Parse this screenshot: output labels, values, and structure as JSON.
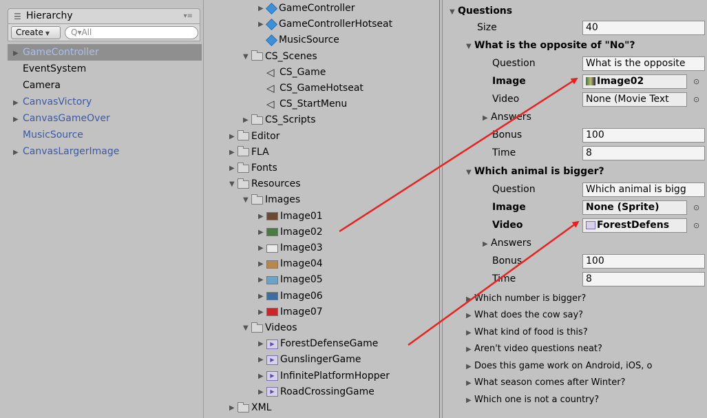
{
  "hierarchy": {
    "title": "Hierarchy",
    "create_label": "Create",
    "search_placeholder": "Q▾All",
    "items": [
      {
        "label": "GameController",
        "selected": true,
        "prefab": true,
        "expandable": true
      },
      {
        "label": "EventSystem",
        "selected": false,
        "prefab": false,
        "expandable": false
      },
      {
        "label": "Camera",
        "selected": false,
        "prefab": false,
        "expandable": false
      },
      {
        "label": "CanvasVictory",
        "selected": false,
        "prefab": true,
        "expandable": true
      },
      {
        "label": "CanvasGameOver",
        "selected": false,
        "prefab": true,
        "expandable": true
      },
      {
        "label": "MusicSource",
        "selected": false,
        "prefab": true,
        "expandable": false
      },
      {
        "label": "CanvasLargerImage",
        "selected": false,
        "prefab": true,
        "expandable": true
      }
    ]
  },
  "project": {
    "items": [
      {
        "label": "GameController",
        "icon": "prefab-cube-icon",
        "indent": 3,
        "tri": "▶"
      },
      {
        "label": "GameControllerHotseat",
        "icon": "prefab-cube-icon",
        "indent": 3,
        "tri": "▶"
      },
      {
        "label": "MusicSource",
        "icon": "prefab-cube-icon",
        "indent": 3,
        "tri": ""
      },
      {
        "label": "CS_Scenes",
        "icon": "folder-icon",
        "indent": 2,
        "tri": "▼"
      },
      {
        "label": "CS_Game",
        "icon": "unity-scene-icon",
        "indent": 3,
        "tri": ""
      },
      {
        "label": "CS_GameHotseat",
        "icon": "unity-scene-icon",
        "indent": 3,
        "tri": ""
      },
      {
        "label": "CS_StartMenu",
        "icon": "unity-scene-icon",
        "indent": 3,
        "tri": ""
      },
      {
        "label": "CS_Scripts",
        "icon": "folder-icon",
        "indent": 2,
        "tri": "▶"
      },
      {
        "label": "Editor",
        "icon": "folder-icon",
        "indent": 1,
        "tri": "▶"
      },
      {
        "label": "FLA",
        "icon": "folder-icon",
        "indent": 1,
        "tri": "▶"
      },
      {
        "label": "Fonts",
        "icon": "folder-icon",
        "indent": 1,
        "tri": "▶"
      },
      {
        "label": "Resources",
        "icon": "folder-icon",
        "indent": 1,
        "tri": "▼"
      },
      {
        "label": "Images",
        "icon": "folder-icon",
        "indent": 2,
        "tri": "▼"
      },
      {
        "label": "Image01",
        "icon": "image-thumbnail-icon",
        "indent": 3,
        "tri": "▶",
        "thumb": "#6b4a33"
      },
      {
        "label": "Image02",
        "icon": "image-thumbnail-icon",
        "indent": 3,
        "tri": "▶",
        "thumb": "#4d7a43"
      },
      {
        "label": "Image03",
        "icon": "image-thumbnail-icon",
        "indent": 3,
        "tri": "▶",
        "thumb": "#e9e9e9"
      },
      {
        "label": "Image04",
        "icon": "image-thumbnail-icon",
        "indent": 3,
        "tri": "▶",
        "thumb": "#b7874e"
      },
      {
        "label": "Image05",
        "icon": "image-thumbnail-icon",
        "indent": 3,
        "tri": "▶",
        "thumb": "#6aa3c8"
      },
      {
        "label": "Image06",
        "icon": "image-thumbnail-icon",
        "indent": 3,
        "tri": "▶",
        "thumb": "#3e6d9e"
      },
      {
        "label": "Image07",
        "icon": "image-thumbnail-icon",
        "indent": 3,
        "tri": "▶",
        "thumb": "#c8272c"
      },
      {
        "label": "Videos",
        "icon": "folder-icon",
        "indent": 2,
        "tri": "▼"
      },
      {
        "label": "ForestDefenseGame",
        "icon": "video-clip-icon",
        "indent": 3,
        "tri": "▶"
      },
      {
        "label": "GunslingerGame",
        "icon": "video-clip-icon",
        "indent": 3,
        "tri": "▶"
      },
      {
        "label": "InfinitePlatformHopper",
        "icon": "video-clip-icon",
        "indent": 3,
        "tri": "▶"
      },
      {
        "label": "RoadCrossingGame",
        "icon": "video-clip-icon",
        "indent": 3,
        "tri": "▶"
      },
      {
        "label": "XML",
        "icon": "folder-icon",
        "indent": 1,
        "tri": "▶"
      }
    ]
  },
  "inspector": {
    "questions_label": "Questions",
    "size_label": "Size",
    "size_value": "40",
    "q1": {
      "title": "What is the opposite of \"No\"?",
      "question_label": "Question",
      "question_value": "What is the opposite",
      "image_label": "Image",
      "image_value": "Image02",
      "video_label": "Video",
      "video_value": "None (Movie Text",
      "answers_label": "Answers",
      "bonus_label": "Bonus",
      "bonus_value": "100",
      "time_label": "Time",
      "time_value": "8"
    },
    "q2": {
      "title": "Which animal is bigger?",
      "question_label": "Question",
      "question_value": "Which animal is bigg",
      "image_label": "Image",
      "image_value": "None (Sprite)",
      "video_label": "Video",
      "video_value": "ForestDefens",
      "answers_label": "Answers",
      "bonus_label": "Bonus",
      "bonus_value": "100",
      "time_label": "Time",
      "time_value": "8"
    },
    "collapsed": [
      "Which number is bigger?",
      "What does the cow say?",
      "What kind of food is this?",
      "Aren't video questions neat?",
      "Does this game work on Android, iOS, o",
      "What season comes after Winter?",
      "Which one is not a country?"
    ]
  },
  "colors": {
    "panel": "#c2c2c2",
    "selection": "#8f8f8f",
    "prefab_text": "#3b59a7",
    "arrow": "#e8231f"
  }
}
